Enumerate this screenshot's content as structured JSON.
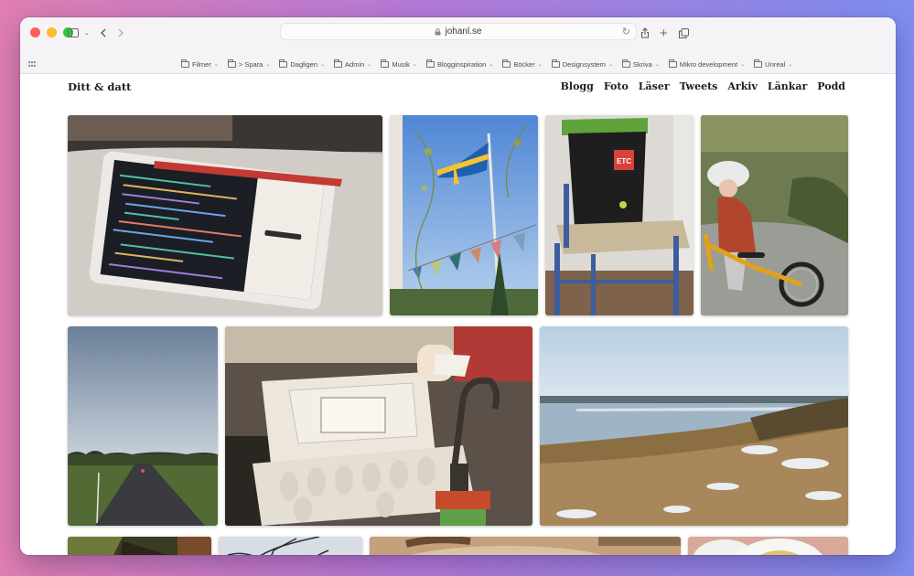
{
  "browser": {
    "url": "johanl.se",
    "bookmarks": [
      {
        "label": "Filmer"
      },
      {
        "label": "> Spara"
      },
      {
        "label": "Dagligen"
      },
      {
        "label": "Admin"
      },
      {
        "label": "Musik"
      },
      {
        "label": "Blogginspiration"
      },
      {
        "label": "Böcker"
      },
      {
        "label": "Designsystem"
      },
      {
        "label": "Skriva"
      },
      {
        "label": "Mikro development"
      },
      {
        "label": "Unreal"
      }
    ]
  },
  "site": {
    "title": "Ditt & datt",
    "nav": [
      "Blogg",
      "Foto",
      "Läser",
      "Tweets",
      "Arkiv",
      "Länkar",
      "Podd"
    ]
  },
  "photos": [
    {
      "name": "photo-ipad-code"
    },
    {
      "name": "photo-swedish-flag"
    },
    {
      "name": "photo-compost-bin"
    },
    {
      "name": "photo-child-balance-bike"
    },
    {
      "name": "photo-rainy-road"
    },
    {
      "name": "photo-egg-carton-kitchen"
    },
    {
      "name": "photo-frozen-lake"
    },
    {
      "name": "photo-forest-partial"
    },
    {
      "name": "photo-bare-tree-partial"
    },
    {
      "name": "photo-baking-partial"
    },
    {
      "name": "photo-pancake-plate-partial"
    }
  ],
  "colors": {
    "traffic_red": "#fe5f57",
    "traffic_yellow": "#febc2e",
    "traffic_green": "#28c840"
  }
}
